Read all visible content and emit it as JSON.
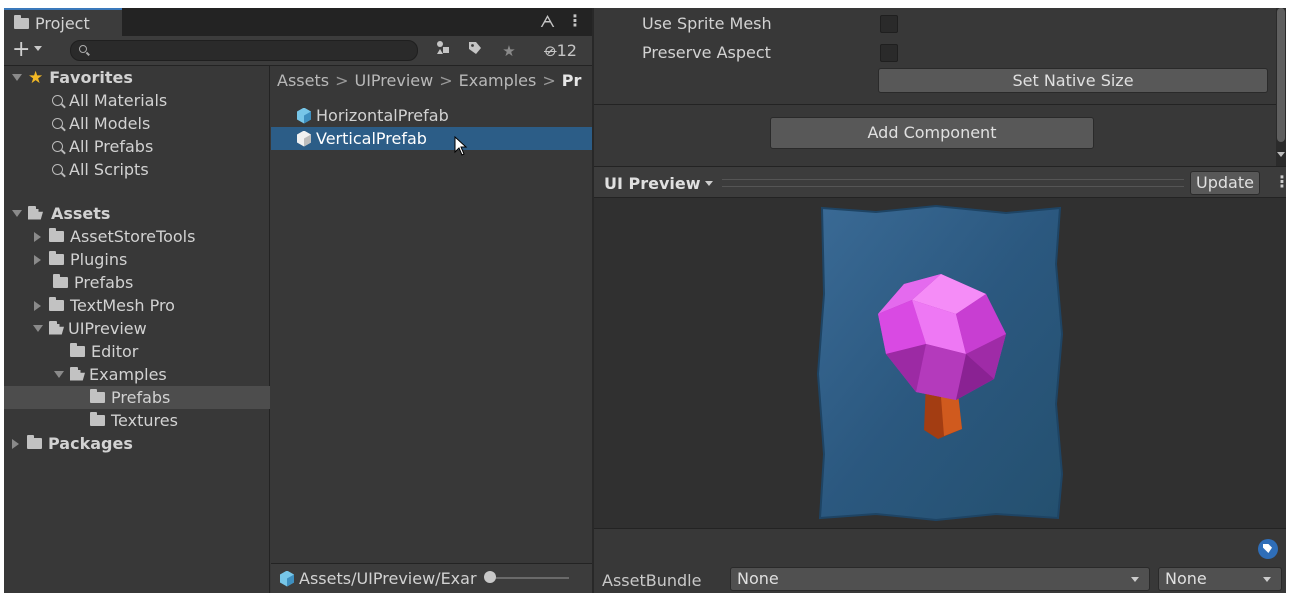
{
  "project": {
    "tab_label": "Project",
    "hidden_count": "12",
    "search_placeholder": ""
  },
  "favorites": {
    "label": "Favorites",
    "items": [
      "All Materials",
      "All Models",
      "All Prefabs",
      "All Scripts"
    ]
  },
  "tree": {
    "assets": "Assets",
    "asset_store_tools": "AssetStoreTools",
    "plugins": "Plugins",
    "prefabs": "Prefabs",
    "textmesh_pro": "TextMesh Pro",
    "uipreview": "UIPreview",
    "editor": "Editor",
    "examples": "Examples",
    "examples_prefabs": "Prefabs",
    "textures": "Textures",
    "packages": "Packages"
  },
  "breadcrumb": {
    "items": [
      "Assets",
      "UIPreview",
      "Examples"
    ],
    "current": "Pr"
  },
  "assets_list": {
    "items": [
      "HorizontalPrefab",
      "VerticalPrefab"
    ],
    "selected": "VerticalPrefab"
  },
  "status": {
    "path": "Assets/UIPreview/Exar"
  },
  "inspector": {
    "use_sprite_mesh": "Use Sprite Mesh",
    "preserve_aspect": "Preserve Aspect",
    "set_native_size": "Set Native Size",
    "add_component": "Add Component"
  },
  "preview": {
    "title": "UI Preview",
    "update": "Update"
  },
  "asset_bundle": {
    "label": "AssetBundle",
    "name_value": "None",
    "variant_value": "None"
  },
  "colors": {
    "selection": "#2c5d87",
    "accent_tab": "#3a79bb",
    "gem": "#d84ae0",
    "card": "#2d5a82"
  }
}
